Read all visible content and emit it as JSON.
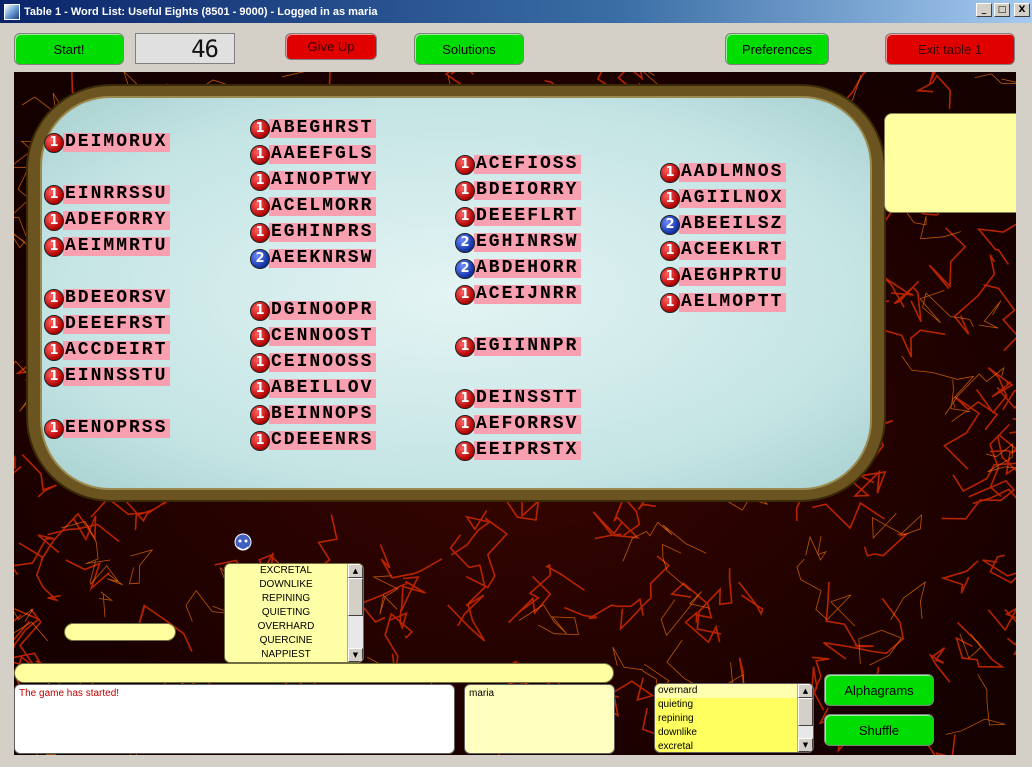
{
  "window": {
    "title": "Table 1 - Word List: Useful Eights (8501 - 9000) - Logged in as maria",
    "minimize": "_",
    "maximize": "□",
    "close": "X"
  },
  "toolbar": {
    "start": "Start!",
    "timer": "46",
    "give_up": "Give Up",
    "solutions": "Solutions",
    "preferences": "Preferences",
    "exit": "Exit table 1"
  },
  "columns": [
    [
      {
        "n": "1",
        "letters": "DEIMORUX",
        "color": "red"
      },
      {
        "gap": true
      },
      {
        "n": "1",
        "letters": "EINRRSSU",
        "color": "red"
      },
      {
        "n": "1",
        "letters": "ADEFORRY",
        "color": "red"
      },
      {
        "n": "1",
        "letters": "AEIMMRTU",
        "color": "red"
      },
      {
        "gap": true
      },
      {
        "n": "1",
        "letters": "BDEEORSV",
        "color": "red"
      },
      {
        "n": "1",
        "letters": "DEEEFRST",
        "color": "red"
      },
      {
        "n": "1",
        "letters": "ACCDEIRT",
        "color": "red"
      },
      {
        "n": "1",
        "letters": "EINNSSTU",
        "color": "red"
      },
      {
        "gap": true
      },
      {
        "n": "1",
        "letters": "EENOPRSS",
        "color": "red"
      }
    ],
    [
      {
        "n": "1",
        "letters": "ABEGHRST",
        "color": "red"
      },
      {
        "n": "1",
        "letters": "AAEEFGLS",
        "color": "red"
      },
      {
        "n": "1",
        "letters": "AINOPTWY",
        "color": "red"
      },
      {
        "n": "1",
        "letters": "ACELMORR",
        "color": "red"
      },
      {
        "n": "1",
        "letters": "EGHINPRS",
        "color": "red"
      },
      {
        "n": "2",
        "letters": "AEEKNRSW",
        "color": "blue"
      },
      {
        "gap": true
      },
      {
        "n": "1",
        "letters": "DGINOOPR",
        "color": "red"
      },
      {
        "n": "1",
        "letters": "CENNOOST",
        "color": "red"
      },
      {
        "n": "1",
        "letters": "CEINOOSS",
        "color": "red"
      },
      {
        "n": "1",
        "letters": "ABEILLOV",
        "color": "red"
      },
      {
        "n": "1",
        "letters": "BEINNOPS",
        "color": "red"
      },
      {
        "n": "1",
        "letters": "CDEEENRS",
        "color": "red"
      }
    ],
    [
      {
        "n": "1",
        "letters": "ACEFIOSS",
        "color": "red"
      },
      {
        "n": "1",
        "letters": "BDEIORRY",
        "color": "red"
      },
      {
        "n": "1",
        "letters": "DEEEFLRT",
        "color": "red"
      },
      {
        "n": "2",
        "letters": "EGHINRSW",
        "color": "blue"
      },
      {
        "n": "2",
        "letters": "ABDEHORR",
        "color": "blue"
      },
      {
        "n": "1",
        "letters": "ACEIJNRR",
        "color": "red"
      },
      {
        "gap": true
      },
      {
        "n": "1",
        "letters": "EGIINNPR",
        "color": "red"
      },
      {
        "gap": true
      },
      {
        "n": "1",
        "letters": "DEINSSTT",
        "color": "red"
      },
      {
        "n": "1",
        "letters": "AEFORRSV",
        "color": "red"
      },
      {
        "n": "1",
        "letters": "EEIPRSTX",
        "color": "red"
      }
    ],
    [
      {
        "n": "1",
        "letters": "AADLMNOS",
        "color": "red"
      },
      {
        "n": "1",
        "letters": "AGIILNOX",
        "color": "red"
      },
      {
        "n": "2",
        "letters": "ABEEILSZ",
        "color": "blue"
      },
      {
        "n": "1",
        "letters": "ACEEKLRT",
        "color": "red"
      },
      {
        "n": "1",
        "letters": "AEGHPRTU",
        "color": "red"
      },
      {
        "n": "1",
        "letters": "AELMOPTT",
        "color": "red"
      }
    ]
  ],
  "guesses": [
    "EXCRETAL",
    "DOWNLIKE",
    "REPINING",
    "QUIETING",
    "OVERHARD",
    "QUERCINE",
    "NAPPIEST"
  ],
  "chat": {
    "message": "The game has started!",
    "input": ""
  },
  "users": [
    "maria"
  ],
  "my_solutions": [
    "overnard",
    "quieting",
    "repining",
    "downlike",
    "excretal"
  ],
  "side_buttons": {
    "alphagrams": "Alphagrams",
    "shuffle": "Shuffle"
  },
  "colors": {
    "green": "#00dd00",
    "red": "#e00000",
    "tile": "#f8a0b0",
    "felt": "#c4e4e4"
  }
}
